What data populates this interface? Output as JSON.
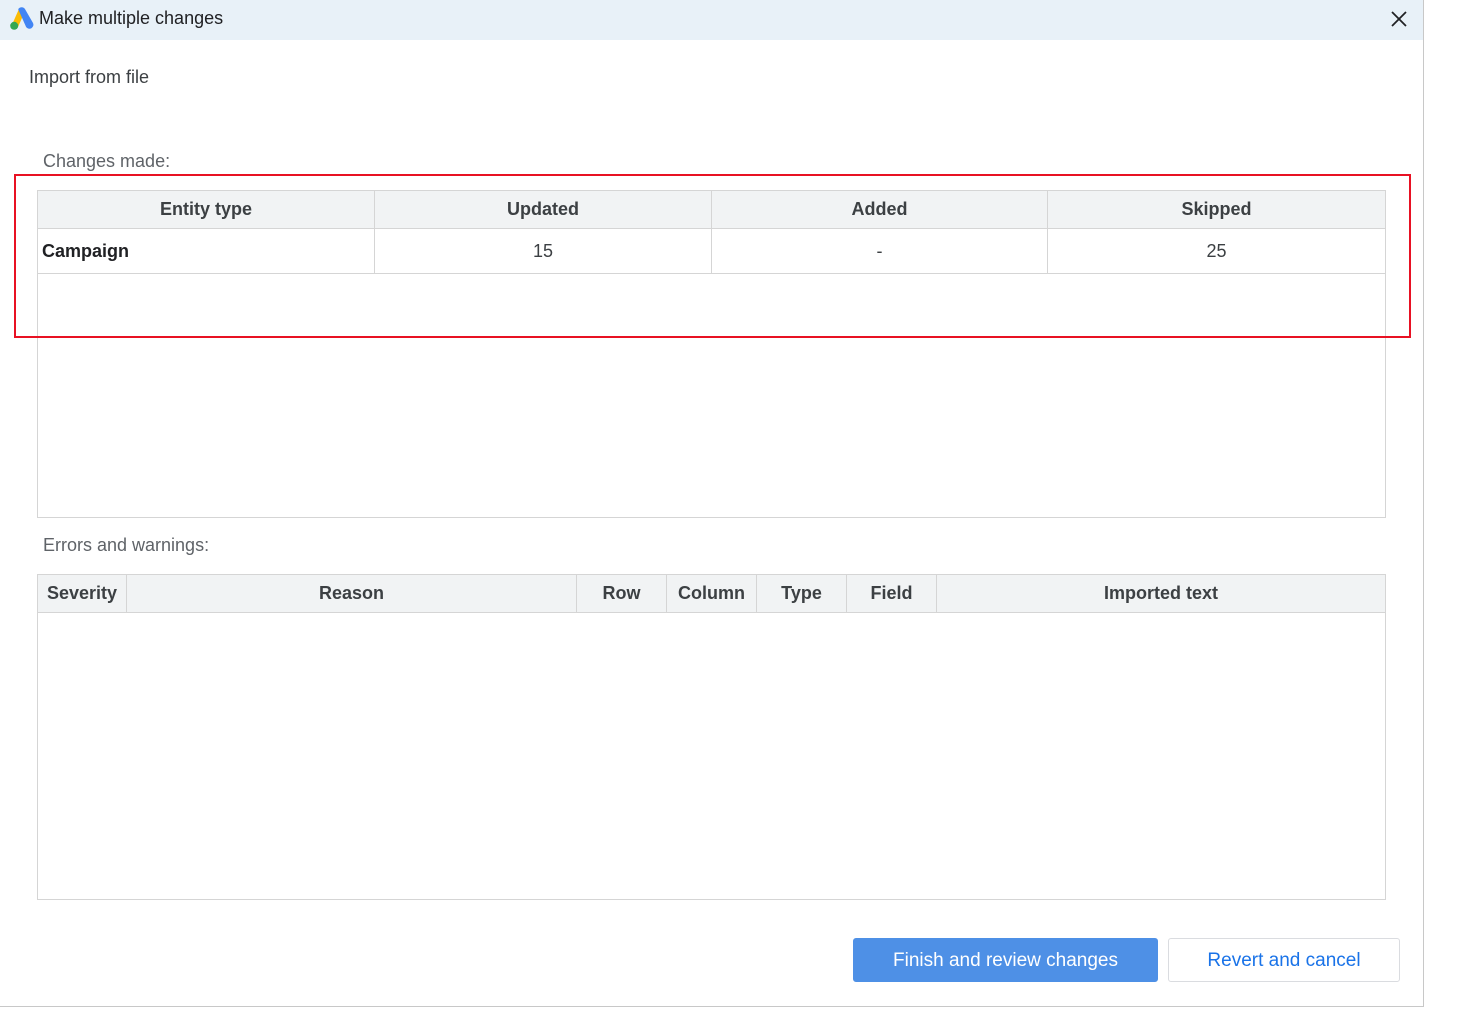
{
  "window": {
    "title": "Make multiple changes",
    "logo_icon": "google-ads-logo-icon",
    "close_icon": "close-icon"
  },
  "subtitle": "Import from file",
  "changes": {
    "label": "Changes made:",
    "columns": [
      "Entity type",
      "Updated",
      "Added",
      "Skipped"
    ],
    "rows": [
      {
        "entity": "Campaign",
        "updated": "15",
        "added": "-",
        "skipped": "25"
      }
    ]
  },
  "errors": {
    "label": "Errors and warnings:",
    "columns": [
      "Severity",
      "Reason",
      "Row",
      "Column",
      "Type",
      "Field",
      "Imported text"
    ],
    "rows": []
  },
  "buttons": {
    "finish": "Finish and review changes",
    "revert": "Revert and cancel"
  },
  "colors": {
    "titlebar": "#e8f1f8",
    "primary_button": "#4e90e6",
    "link_blue": "#1a73e8",
    "highlight": "#e81123"
  }
}
